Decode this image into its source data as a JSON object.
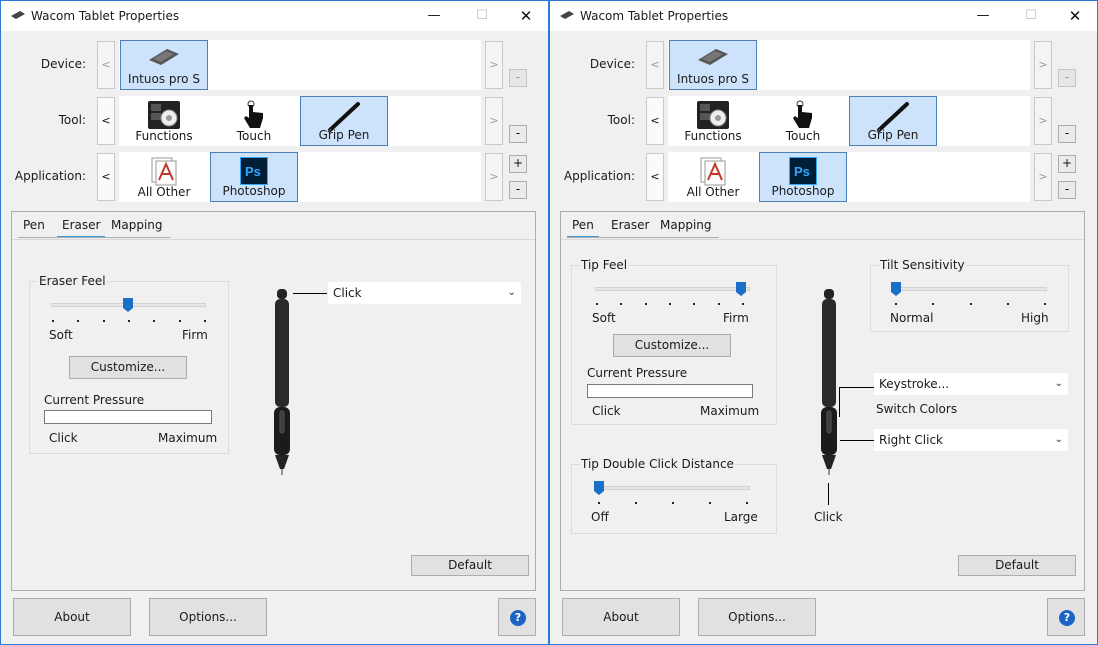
{
  "window_title": "Wacom Tablet Properties",
  "labels": {
    "device": "Device:",
    "tool": "Tool:",
    "application": "Application:"
  },
  "device": {
    "name": "Intuos pro S"
  },
  "tools": [
    {
      "label": "Functions"
    },
    {
      "label": "Touch"
    },
    {
      "label": "Grip Pen"
    }
  ],
  "applications": [
    {
      "label": "All Other"
    },
    {
      "label": "Photoshop"
    }
  ],
  "tabs": [
    "Pen",
    "Eraser",
    "Mapping"
  ],
  "left": {
    "active_tab": "Eraser",
    "eraser_feel": {
      "label": "Eraser Feel",
      "min": "Soft",
      "max": "Firm",
      "position": 4,
      "ticks": 7
    },
    "customize": "Customize...",
    "current_pressure": {
      "label": "Current Pressure",
      "min": "Click",
      "max": "Maximum"
    },
    "eraser_action": "Click",
    "default": "Default"
  },
  "right": {
    "active_tab": "Pen",
    "tip_feel": {
      "label": "Tip Feel",
      "min": "Soft",
      "max": "Firm",
      "position": 7,
      "ticks": 7
    },
    "customize": "Customize...",
    "current_pressure": {
      "label": "Current Pressure",
      "min": "Click",
      "max": "Maximum"
    },
    "tip_double_click": {
      "label": "Tip Double Click Distance",
      "min": "Off",
      "max": "Large",
      "position": 1,
      "ticks": 5
    },
    "tilt": {
      "label": "Tilt Sensitivity",
      "min": "Normal",
      "max": "High",
      "position": 1,
      "ticks": 5
    },
    "upper_button": "Keystroke...",
    "upper_button_detail": "Switch Colors",
    "lower_button": "Right Click",
    "tip_action": "Click",
    "default": "Default"
  },
  "buttons": {
    "about": "About",
    "options": "Options...",
    "help": "?",
    "plus": "+",
    "minus": "-",
    "prev": "<",
    "next": ">"
  },
  "colors": {
    "selection": "#cde3fb",
    "selection_border": "#4a7fb7",
    "tab_accent": "#3c9bd8",
    "slider_thumb": "#1a6fc8",
    "photoshop_blue": "#31a8ff",
    "photoshop_bg": "#001e36",
    "window_border": "#2b79d8"
  }
}
